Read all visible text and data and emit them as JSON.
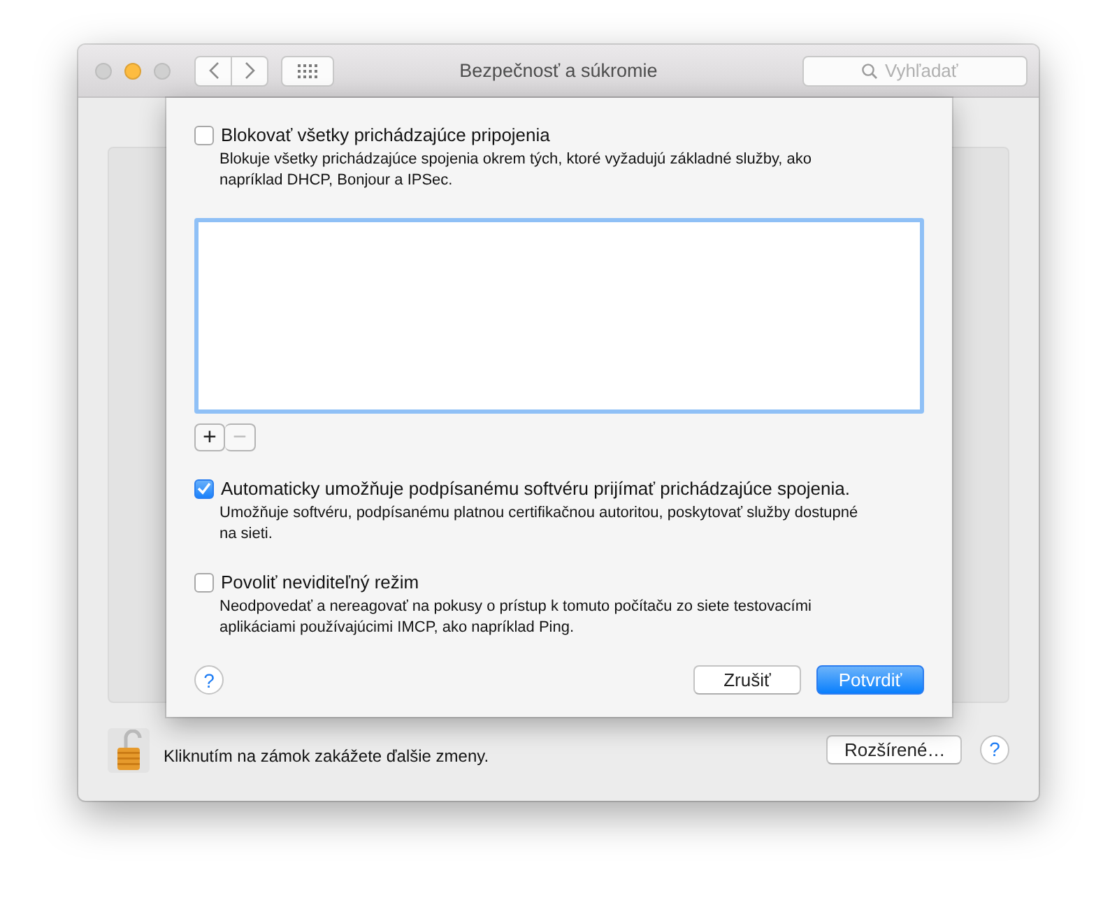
{
  "window": {
    "title": "Bezpečnosť a súkromie",
    "traffic_lights": [
      {
        "kind": "close",
        "disabled": true
      },
      {
        "kind": "minimize",
        "disabled": false
      },
      {
        "kind": "zoom",
        "disabled": true
      }
    ],
    "search": {
      "placeholder": "Vyhľadať"
    }
  },
  "sheet": {
    "options": [
      {
        "label": "Blokovať všetky prichádzajúce pripojenia",
        "description": "Blokuje všetky prichádzajúce spojenia okrem tých, ktoré vyžadujú základné služby, ako napríklad DHCP, Bonjour a IPSec.",
        "checked": false
      }
    ],
    "list_buttons": [
      {
        "label": "+",
        "disabled": false
      },
      {
        "label": "−",
        "disabled": true
      }
    ],
    "more_options": [
      {
        "label": "Automaticky umožňuje podpísanému softvéru prijímať prichádzajúce spojenia.",
        "description": "Umožňuje softvéru, podpísanému platnou certifikačnou autoritou, poskytovať služby dostupné na sieti.",
        "checked": true
      },
      {
        "label": "Povoliť neviditeľný režim",
        "description": "Neodpovedať a nereagovať na pokusy o prístup k tomuto počítaču zo siete testovacími aplikáciami používajúcimi IMCP, ako napríklad Ping.",
        "checked": false
      }
    ],
    "help": "?",
    "buttons": [
      {
        "label": "Zrušiť",
        "default": false
      },
      {
        "label": "Potvrdiť",
        "default": true
      }
    ]
  },
  "footer": {
    "lock_text": "Kliknutím na zámok zakážete ďalšie zmeny.",
    "advanced_button": "Rozšírené…",
    "help": "?"
  }
}
